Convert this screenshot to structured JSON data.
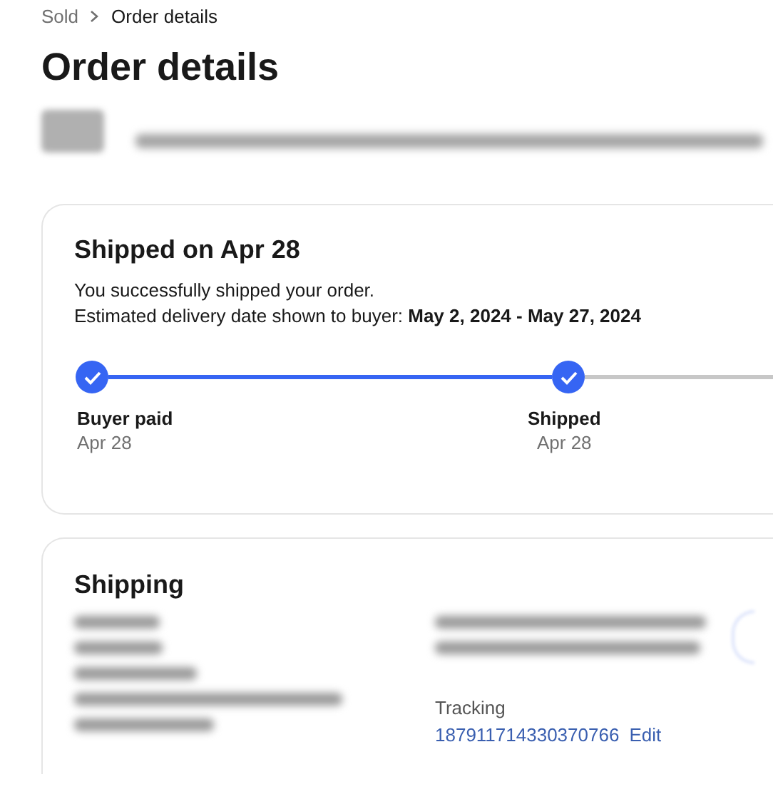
{
  "breadcrumb": [
    {
      "label": "Sold",
      "current": false
    },
    {
      "label": "Order details",
      "current": true
    }
  ],
  "title": "Order details",
  "status_card": {
    "heading": "Shipped on Apr 28",
    "message": "You successfully shipped your order.",
    "estimate": "Estimated delivery date shown to buyer: **May 2, 2024 - May 27, 2024**",
    "steps": [
      {
        "label": "Buyer paid",
        "date": "Apr 28",
        "done": true
      },
      {
        "label": "Shipped",
        "date": "Apr 28",
        "done": true
      }
    ]
  },
  "shipping_card": {
    "heading": "Shipping",
    "tracking_label": "Tracking",
    "tracking_number": "187911714330370766",
    "edit_link": "Edit"
  }
}
